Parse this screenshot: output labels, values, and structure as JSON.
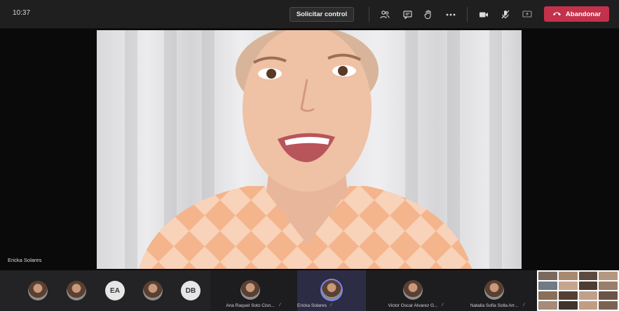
{
  "topbar": {
    "time": "10:37",
    "request_control_label": "Solicitar control",
    "leave_label": "Abandonar",
    "icons": [
      "participants-icon",
      "chat-icon",
      "raise-hand-icon",
      "more-icon",
      "camera-icon",
      "mic-muted-icon",
      "share-screen-icon",
      "phone-hangup-icon"
    ]
  },
  "stage": {
    "speaker_name": "Ericka Solares"
  },
  "participants": {
    "plain": [
      {
        "type": "photo"
      },
      {
        "type": "photo"
      },
      {
        "type": "initials",
        "initials": "EA"
      },
      {
        "type": "photo"
      },
      {
        "type": "initials",
        "initials": "DB"
      }
    ],
    "named": [
      {
        "name": "Ana Raquel Soto Cisn...",
        "active": false
      },
      {
        "name": "Ericka Solares",
        "active": true
      },
      {
        "name": "Victor Oscar Alvarez G...",
        "active": false
      },
      {
        "name": "Natalia Sofia Solla Arr...",
        "active": false
      }
    ]
  },
  "colors": {
    "leave_red": "#c4314b",
    "active_ring": "#7f85f5",
    "topbar_bg": "#1f1f1f"
  }
}
